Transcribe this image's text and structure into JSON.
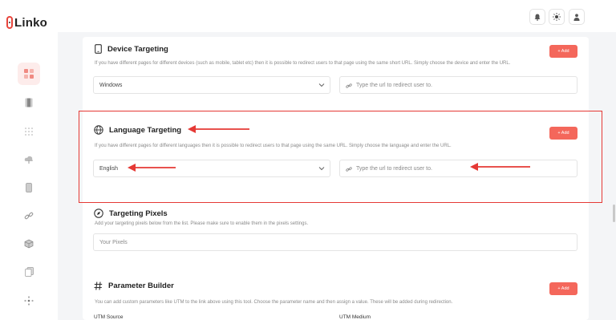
{
  "app": {
    "name": "Linko"
  },
  "sidebar": {
    "items": [
      {
        "icon": "dashboard-icon",
        "active": true
      },
      {
        "icon": "bookmark-icon",
        "active": false
      },
      {
        "icon": "grid-dots-icon",
        "active": false
      },
      {
        "icon": "cloud-icon",
        "active": false
      },
      {
        "icon": "mobile-icon",
        "active": false
      },
      {
        "icon": "link-icon",
        "active": false
      },
      {
        "icon": "box-icon",
        "active": false
      },
      {
        "icon": "copy-icon",
        "active": false
      },
      {
        "icon": "move-icon",
        "active": false
      }
    ]
  },
  "topbar": {
    "buttons": [
      "bell-icon",
      "sun-icon",
      "user-icon"
    ]
  },
  "device_targeting": {
    "title": "Device Targeting",
    "description": "If you have different pages for different devices (such as mobile, tablet etc) then it is possible to redirect users to that page using the same short URL. Simply choose the device and enter the URL.",
    "add_label": "+ Add",
    "select_value": "Windows",
    "url_placeholder": "Type the url to redirect user to."
  },
  "language_targeting": {
    "title": "Language Targeting",
    "description": "If you have different pages for different languages then it is possible to redirect users to that page using the same URL. Simply choose the language and enter the URL.",
    "add_label": "+ Add",
    "select_value": "English",
    "url_placeholder": "Type the url to redirect user to."
  },
  "targeting_pixels": {
    "title": "Targeting Pixels",
    "description": "Add your targeting pixels below from the list. Please make sure to enable them in the pixels settings.",
    "placeholder": "Your Pixels"
  },
  "parameter_builder": {
    "title": "Parameter Builder",
    "description": "You can add custom parameters like UTM to the link above using this tool. Choose the parameter name and then assign a value. These will be added during redirection.",
    "add_label": "+ Add",
    "field1_label": "UTM Source",
    "field2_label": "UTM Medium"
  },
  "colors": {
    "accent": "#f4675b",
    "annotation": "#e53935",
    "active_nav_bg": "#fdeceb"
  }
}
